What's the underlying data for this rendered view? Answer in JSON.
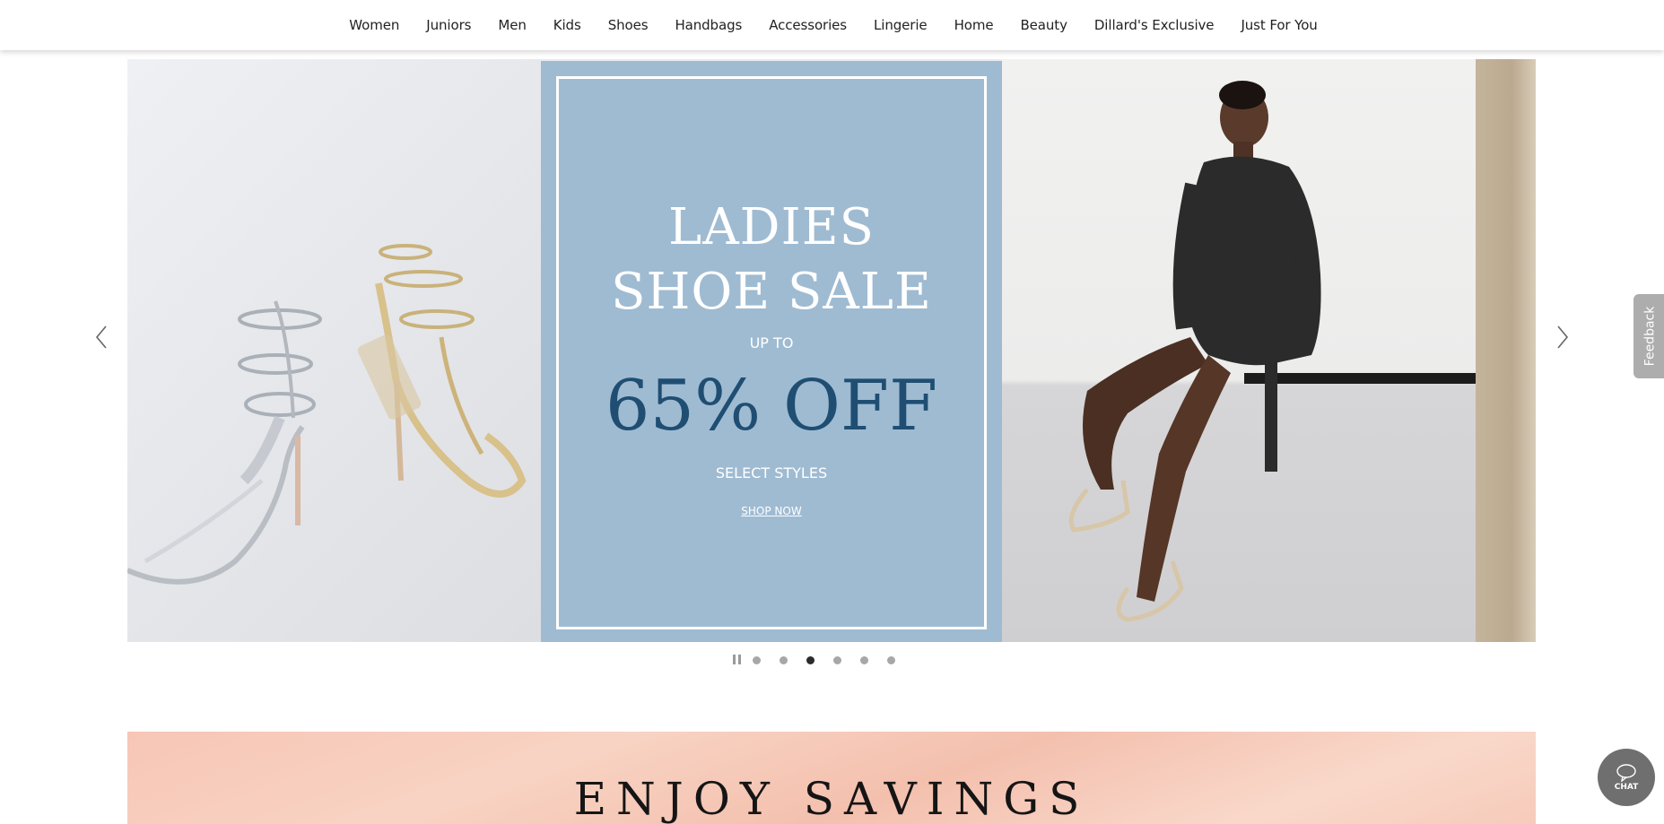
{
  "nav": {
    "items": [
      {
        "label": "Women"
      },
      {
        "label": "Juniors"
      },
      {
        "label": "Men"
      },
      {
        "label": "Kids"
      },
      {
        "label": "Shoes"
      },
      {
        "label": "Handbags"
      },
      {
        "label": "Accessories"
      },
      {
        "label": "Lingerie"
      },
      {
        "label": "Home"
      },
      {
        "label": "Beauty"
      },
      {
        "label": "Dillard's Exclusive"
      },
      {
        "label": "Just For You"
      }
    ]
  },
  "hero": {
    "title_line1": "LADIES",
    "title_line2": "SHOE SALE",
    "up_to": "UP TO",
    "discount": "65% OFF",
    "select_styles": "SELECT STYLES",
    "cta": "SHOP NOW",
    "colors": {
      "panel_blue": "#9fbbd2",
      "discount_text": "#1f4e72"
    }
  },
  "carousel": {
    "slide_count": 6,
    "active_index": 3,
    "controls": {
      "prev_icon": "chevron-left-icon",
      "next_icon": "chevron-right-icon",
      "pause_icon": "pause-icon"
    }
  },
  "promo": {
    "title": "ENJOY SAVINGS"
  },
  "feedback": {
    "label": "Feedback"
  },
  "chat": {
    "label": "CHAT",
    "icon": "chat-bubble-icon"
  }
}
